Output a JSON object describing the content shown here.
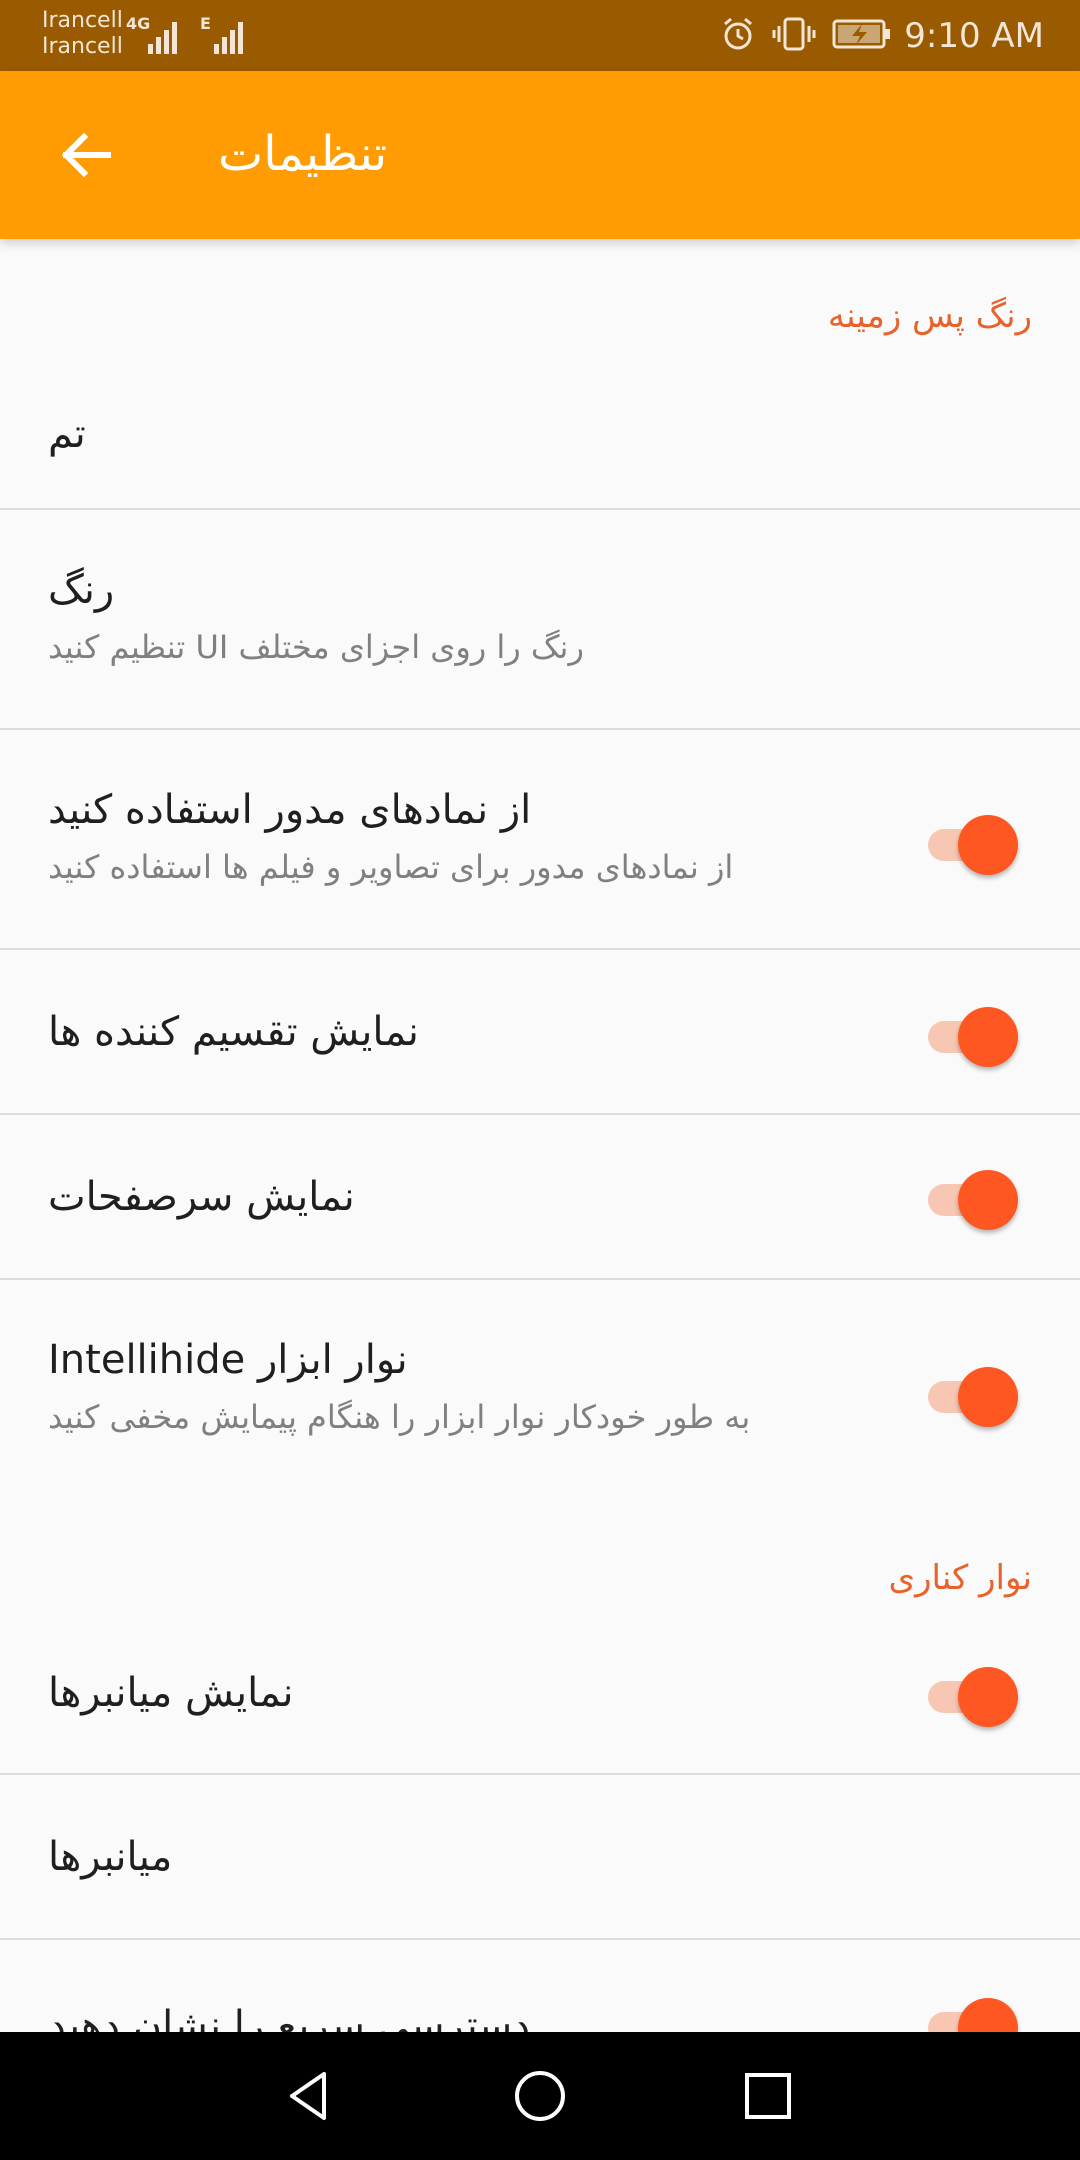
{
  "status_bar": {
    "carrier_1": "Irancell",
    "carrier_2": "Irancell",
    "network_1": "4G",
    "network_2": "E",
    "time": "9:10 AM"
  },
  "app_bar": {
    "title": "تنظیمات",
    "back_icon": "arrow-left-icon",
    "background_color": "#ff9c04"
  },
  "sections": [
    {
      "header": "رنگ پس زمینه",
      "items": [
        {
          "title": "تم"
        },
        {
          "title": "رنگ",
          "summary": "رنگ را روی اجزای مختلف UI تنظیم کنید"
        },
        {
          "title": "از نمادهای مدور استفاده کنید",
          "summary": "از نمادهای مدور برای تصاویر و فیلم ها استفاده کنید",
          "switch_on": true
        },
        {
          "title": "نمایش تقسیم کننده ها",
          "switch_on": true
        },
        {
          "title": "نمایش سرصفحات",
          "switch_on": true
        },
        {
          "title": "نوار ابزار Intellihide",
          "summary": "به طور خودکار نوار ابزار را هنگام پیمایش مخفی کنید",
          "switch_on": true
        }
      ]
    },
    {
      "header": "نوار کناری",
      "items": [
        {
          "title": "نمایش میانبرها",
          "switch_on": true
        },
        {
          "title": "میانبرها"
        },
        {
          "title": "دسترسی سریع را نشان دهید",
          "switch_on": true
        }
      ]
    }
  ],
  "nav_bar": {
    "back_icon": "triangle-back-icon",
    "home_icon": "circle-home-icon",
    "recents_icon": "square-recents-icon"
  },
  "colors": {
    "accent": "#ff5722",
    "category_header": "#e8632c",
    "status_bar": "#9a5a00"
  }
}
